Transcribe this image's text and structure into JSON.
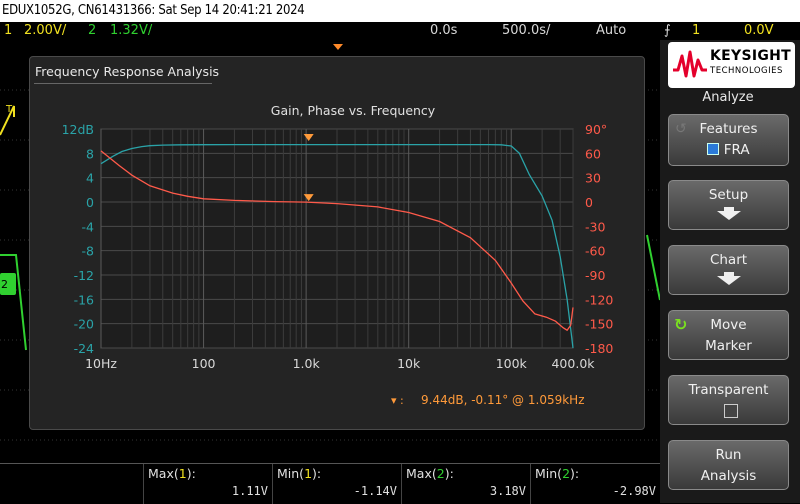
{
  "title": "EDUX1052G, CN61431366: Sat Sep 14 20:41:21 2024",
  "status": {
    "ch1_num": "1",
    "ch1_scale": "2.00V/",
    "ch2_num": "2",
    "ch2_scale": "1.32V/",
    "time_pos": "0.0s",
    "time_scale": "500.0s/",
    "trigger_mode": "Auto",
    "trigger_ch": "1",
    "trigger_level": "0.0V"
  },
  "dialog": {
    "title": "Frequency Response Analysis",
    "marker_readout": "9.44dB, -0.11° @ 1.059kHz"
  },
  "chart_data": {
    "type": "line",
    "title": "Gain, Phase vs. Frequency",
    "xscale": "log",
    "xlim": [
      10,
      400000
    ],
    "x_ticks": [
      "10Hz",
      "100",
      "1.0k",
      "10k",
      "100k",
      "400.0k"
    ],
    "x_tick_values": [
      10,
      100,
      1000,
      10000,
      100000,
      400000
    ],
    "left_axis": {
      "unit": "dB",
      "ylim": [
        -24,
        12
      ],
      "ticks": [
        "12dB",
        "8",
        "4",
        "0",
        "-4",
        "-8",
        "-12",
        "-16",
        "-20",
        "-24"
      ],
      "color": "#2aa3a8"
    },
    "right_axis": {
      "unit": "°",
      "ylim": [
        -180,
        90
      ],
      "ticks": [
        "90°",
        "60",
        "30",
        "0",
        "-30",
        "-60",
        "-90",
        "-120",
        "-150",
        "-180"
      ],
      "color": "#ff5a4a"
    },
    "grid": true,
    "series": [
      {
        "axis": "left",
        "color": "#2aa3a8",
        "x": [
          10,
          13,
          16,
          20,
          25,
          30,
          40,
          60,
          100,
          200,
          500,
          1000,
          3000,
          10000,
          30000,
          60000,
          80000,
          100000,
          120000,
          150000,
          200000,
          250000,
          300000,
          350000,
          400000
        ],
        "y": [
          6.3,
          7.5,
          8.3,
          8.8,
          9.1,
          9.25,
          9.35,
          9.4,
          9.42,
          9.44,
          9.44,
          9.44,
          9.44,
          9.44,
          9.44,
          9.43,
          9.4,
          9.2,
          8.0,
          4.5,
          1.0,
          -3.0,
          -9.0,
          -16.0,
          -24.0
        ]
      },
      {
        "axis": "right",
        "color": "#ff5a4a",
        "x": [
          10,
          15,
          20,
          30,
          50,
          70,
          100,
          200,
          500,
          1000,
          2000,
          5000,
          10000,
          20000,
          40000,
          70000,
          100000,
          130000,
          170000,
          220000,
          270000,
          320000,
          350000,
          380000,
          400000
        ],
        "y": [
          63,
          45,
          33,
          20,
          11,
          7,
          4,
          2,
          0.5,
          -0.1,
          -2,
          -6,
          -13,
          -24,
          -44,
          -72,
          -100,
          -122,
          -138,
          -142,
          -147,
          -155,
          -158,
          -152,
          -130
        ]
      }
    ],
    "markers": {
      "x": 1059,
      "gain_db": 9.44,
      "phase_deg": -0.11
    }
  },
  "measurements": [
    {
      "label": "Max(",
      "ch": "1",
      "tail": "):",
      "value": "1.11V"
    },
    {
      "label": "Min(",
      "ch": "1",
      "tail": "):",
      "value": "-1.14V"
    },
    {
      "label": "Max(",
      "ch": "2",
      "tail": "):",
      "value": "3.18V"
    },
    {
      "label": "Min(",
      "ch": "2",
      "tail": "):",
      "value": "-2.98V"
    }
  ],
  "side": {
    "brand_name": "KEYSIGHT",
    "brand_sub": "TECHNOLOGIES",
    "menu_title": "Analyze",
    "features_label": "Features",
    "features_value": "FRA",
    "setup_label": "Setup",
    "chart_label": "Chart",
    "move_label": "Move",
    "marker_label": "Marker",
    "transparent_label": "Transparent",
    "run_label": "Run",
    "analysis_label": "Analysis"
  },
  "colors": {
    "ch1": "#f0e020",
    "ch2": "#30d030",
    "gain": "#2aa3a8",
    "phase": "#ff5a4a",
    "accent": "#ff8a2a"
  },
  "icons": [
    "trigger-marker-icon",
    "ch1-ground-marker-icon",
    "ch2-ground-marker-icon",
    "trigger-edge-icon",
    "keysight-wave-icon",
    "back-arrow-icon",
    "checkbox-icon",
    "move-rotate-icon",
    "down-arrow-icon",
    "marker-triangle-icon"
  ]
}
